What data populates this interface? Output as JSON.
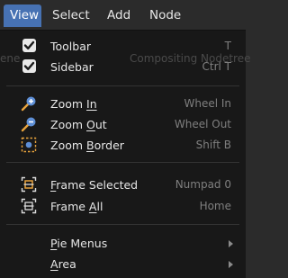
{
  "menubar": {
    "items": [
      {
        "label": "View",
        "active": true
      },
      {
        "label": "Select",
        "active": false
      },
      {
        "label": "Add",
        "active": false
      },
      {
        "label": "Node",
        "active": false
      }
    ]
  },
  "background": {
    "left_text": "ene",
    "editor_text": "Compositing Nodetree"
  },
  "menu": {
    "toolbar": {
      "label": "Toolbar",
      "shortcut": "T",
      "checked": true
    },
    "sidebar": {
      "label": "Sidebar",
      "shortcut": "Ctrl T",
      "checked": true
    },
    "zoom_in": {
      "label": "Zoom In",
      "underline": "I",
      "shortcut": "Wheel In",
      "icon": "zoom-in-icon"
    },
    "zoom_out": {
      "label_pre": "Zoom ",
      "label_u": "O",
      "label_post": "ut",
      "shortcut": "Wheel Out",
      "icon": "zoom-out-icon"
    },
    "zoom_border": {
      "label_pre": "Zoom ",
      "label_u": "B",
      "label_post": "order",
      "shortcut": "Shift B",
      "icon": "zoom-border-icon"
    },
    "frame_selected": {
      "label_u": "F",
      "label_post": "rame Selected",
      "shortcut": "Numpad 0",
      "icon": "frame-selected-icon"
    },
    "frame_all": {
      "label_pre": "Frame ",
      "label_u": "A",
      "label_post": "ll",
      "shortcut": "Home",
      "icon": "frame-all-icon"
    },
    "pie_menus": {
      "label_u": "P",
      "label_post": "ie Menus"
    },
    "area": {
      "label_u": "A",
      "label_post": "rea"
    }
  },
  "colors": {
    "accent": "#4772b3",
    "menu_bg": "#181818",
    "header_bg": "#2b2b2b",
    "shortcut_text": "#7f7f7f",
    "zoom_icon_orange": "#e8a33d",
    "zoom_icon_blue": "#5e8fd6"
  }
}
